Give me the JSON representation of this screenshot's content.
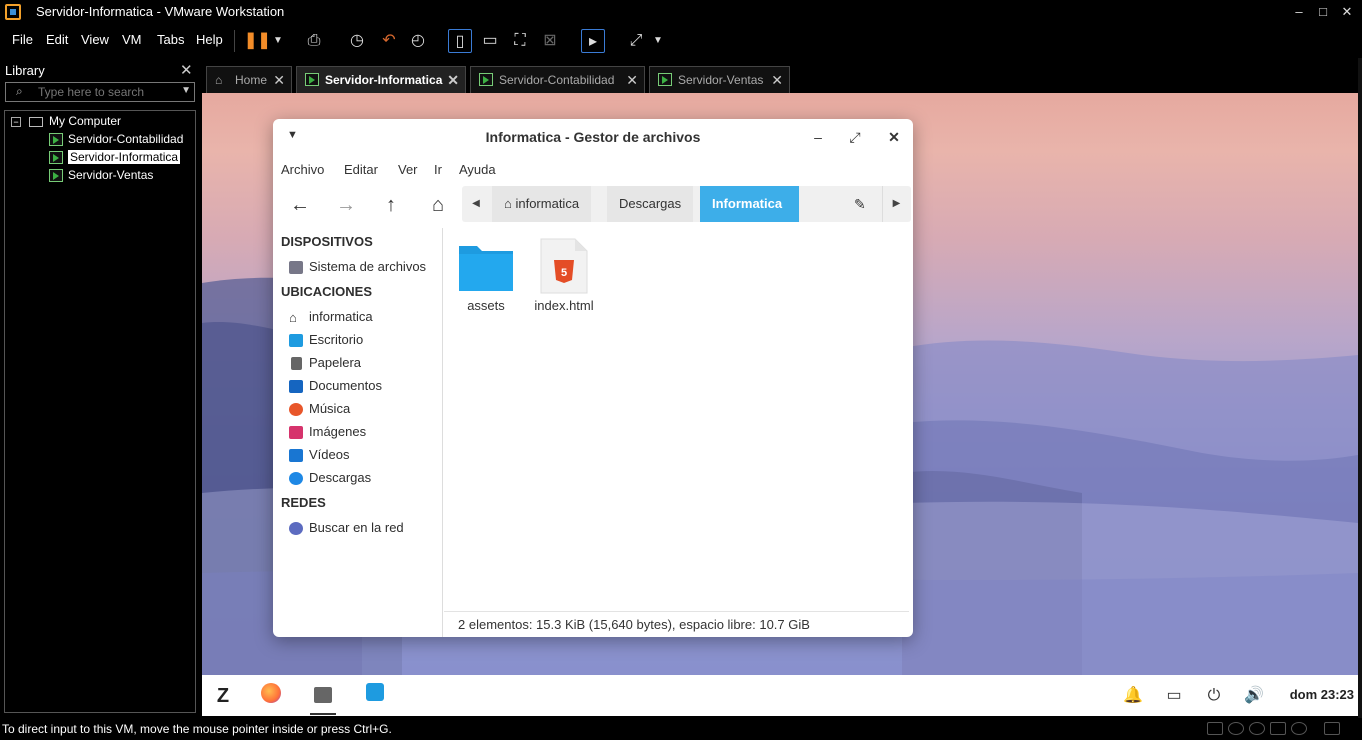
{
  "window": {
    "title": "Servidor-Informatica - VMware Workstation",
    "min": "–",
    "max": "□",
    "close": "✕"
  },
  "menu": [
    "File",
    "Edit",
    "View",
    "VM",
    "Tabs",
    "Help"
  ],
  "library": {
    "title": "Library",
    "close": "✕",
    "search_placeholder": "Type here to search",
    "root": "My Computer",
    "vms": [
      "Servidor-Contabilidad",
      "Servidor-Informatica",
      "Servidor-Ventas"
    ]
  },
  "tabs": [
    {
      "label": "Home",
      "close": "✕"
    },
    {
      "label": "Servidor-Informatica",
      "close": "✕"
    },
    {
      "label": "Servidor-Contabilidad",
      "close": "✕"
    },
    {
      "label": "Servidor-Ventas",
      "close": "✕"
    }
  ],
  "filemanager": {
    "title": "Informatica - Gestor de archivos",
    "menu": [
      "Archivo",
      "Editar",
      "Ver",
      "Ir",
      "Ayuda"
    ],
    "path": [
      "informatica",
      "Descargas",
      "Informatica"
    ],
    "sections": {
      "devices": {
        "title": "DISPOSITIVOS",
        "items": [
          "Sistema de archivos"
        ]
      },
      "places": {
        "title": "UBICACIONES",
        "items": [
          "informatica",
          "Escritorio",
          "Papelera",
          "Documentos",
          "Música",
          "Imágenes",
          "Vídeos",
          "Descargas"
        ]
      },
      "networks": {
        "title": "REDES",
        "items": [
          "Buscar en la red"
        ]
      }
    },
    "files": [
      "assets",
      "index.html"
    ],
    "status": "2 elementos: 15.3 KiB (15,640 bytes), espacio libre: 10.7 GiB"
  },
  "panel": {
    "clock": "dom 23:23"
  },
  "statusbar": {
    "message": "To direct input to this VM, move the mouse pointer inside or press Ctrl+G."
  },
  "colors": {
    "accent": "#3daee9",
    "folder": "#1e9be0",
    "html5": "#e44d26",
    "desktop_top": "#e6a99f",
    "desktop_bottom": "#7b86c6"
  }
}
